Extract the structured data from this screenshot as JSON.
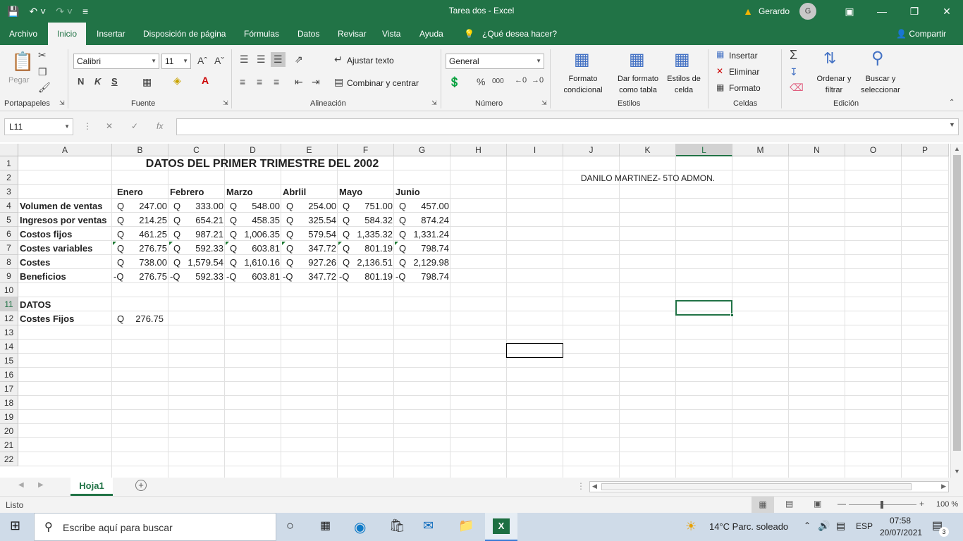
{
  "window": {
    "title": "Tarea dos  -  Excel",
    "user": "Gerardo",
    "avatar_letter": "G"
  },
  "tabs": [
    "Archivo",
    "Inicio",
    "Insertar",
    "Disposición de página",
    "Fórmulas",
    "Datos",
    "Revisar",
    "Vista",
    "Ayuda"
  ],
  "active_tab": "Inicio",
  "tell_me": "¿Qué desea hacer?",
  "share": "Compartir",
  "ribbon": {
    "clipboard": {
      "paste": "Pegar",
      "label": "Portapapeles"
    },
    "font": {
      "name": "Calibri",
      "size": "11",
      "label": "Fuente",
      "bold": "N",
      "italic": "K",
      "underline": "S"
    },
    "alignment": {
      "wrap": "Ajustar texto",
      "merge": "Combinar y centrar",
      "label": "Alineación"
    },
    "number": {
      "format": "General",
      "label": "Número"
    },
    "styles": {
      "conditional_1": "Formato",
      "conditional_2": "condicional",
      "table_1": "Dar formato",
      "table_2": "como tabla",
      "cell_1": "Estilos de",
      "cell_2": "celda",
      "label": "Estilos"
    },
    "cells": {
      "insert": "Insertar",
      "delete": "Eliminar",
      "format": "Formato",
      "label": "Celdas"
    },
    "editing": {
      "sort_1": "Ordenar y",
      "sort_2": "filtrar",
      "find_1": "Buscar y",
      "find_2": "seleccionar",
      "label": "Edición"
    }
  },
  "formula_bar": {
    "name_box": "L11",
    "formula": ""
  },
  "columns": [
    "A",
    "B",
    "C",
    "D",
    "E",
    "F",
    "G",
    "H",
    "I",
    "J",
    "K",
    "L",
    "M",
    "N",
    "O",
    "P"
  ],
  "selected_column": "L",
  "rows": [
    "1",
    "2",
    "3",
    "4",
    "5",
    "6",
    "7",
    "8",
    "9",
    "10",
    "11",
    "12",
    "13",
    "14",
    "15",
    "16",
    "17",
    "18",
    "19",
    "20",
    "21",
    "22"
  ],
  "selected_row": "11",
  "sheet": {
    "title": "DATOS DEL PRIMER TRIMESTRE DEL 2002",
    "author": "DANILO MARTINEZ- 5TO ADMON.",
    "months": [
      "Enero",
      "Febrero",
      "Marzo",
      "Abrlil",
      "Mayo",
      "Junio"
    ],
    "row_labels": [
      "Volumen de ventas",
      "Ingresos por ventas",
      "Costos fijos",
      "Costes variables",
      "Costes",
      "Beneficios"
    ],
    "values": [
      [
        "247.00",
        "333.00",
        "548.00",
        "254.00",
        "751.00",
        "457.00"
      ],
      [
        "214.25",
        "654.21",
        "458.35",
        "325.54",
        "584.32",
        "874.24"
      ],
      [
        "461.25",
        "987.21",
        "1,006.35",
        "579.54",
        "1,335.32",
        "1,331.24"
      ],
      [
        "276.75",
        "592.33",
        "603.81",
        "347.72",
        "801.19",
        "798.74"
      ],
      [
        "738.00",
        "1,579.54",
        "1,610.16",
        "927.26",
        "2,136.51",
        "2,129.98"
      ],
      [
        "276.75",
        "592.33",
        "603.81",
        "347.72",
        "801.19",
        "798.74"
      ]
    ],
    "currency": "Q",
    "negative_currency": "-Q",
    "datos_label": "DATOS",
    "costes_fijos_label": "Costes Fijos",
    "costes_fijos_value": "276.75"
  },
  "sheet_tab": "Hoja1",
  "status": {
    "ready": "Listo",
    "zoom": "100 %"
  },
  "taskbar": {
    "search": "Escribe aquí para buscar",
    "weather": "14°C  Parc. soleado",
    "lang": "ESP",
    "time": "07:58",
    "date": "20/07/2021",
    "notifications": "3"
  }
}
